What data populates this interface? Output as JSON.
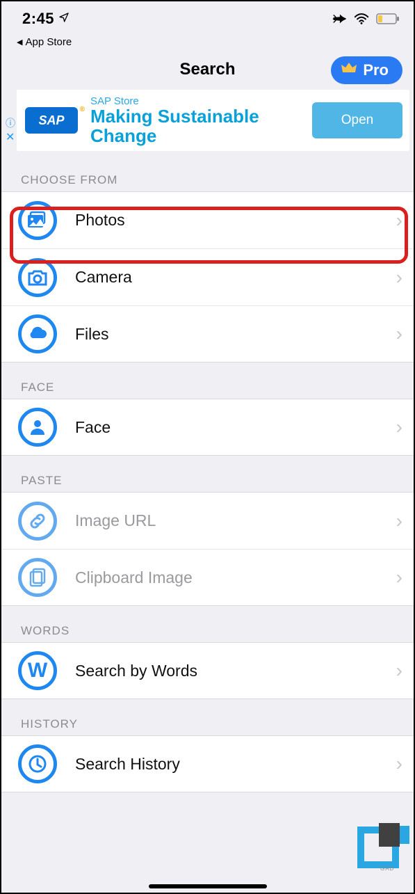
{
  "status_bar": {
    "time": "2:45",
    "back_label": "App Store"
  },
  "header": {
    "title": "Search",
    "pro_label": "Pro"
  },
  "ad": {
    "logo_text": "SAP",
    "store_label": "SAP Store",
    "headline": "Making Sustainable Change",
    "cta": "Open"
  },
  "sections": {
    "choose_from": {
      "header": "CHOOSE FROM",
      "items": [
        {
          "label": "Photos"
        },
        {
          "label": "Camera"
        },
        {
          "label": "Files"
        }
      ]
    },
    "face": {
      "header": "FACE",
      "items": [
        {
          "label": "Face"
        }
      ]
    },
    "paste": {
      "header": "PASTE",
      "items": [
        {
          "label": "Image URL"
        },
        {
          "label": "Clipboard Image"
        }
      ]
    },
    "words": {
      "header": "WORDS",
      "items": [
        {
          "label": "Search by Words"
        }
      ]
    },
    "history": {
      "header": "HISTORY",
      "items": [
        {
          "label": "Search History"
        }
      ]
    }
  }
}
